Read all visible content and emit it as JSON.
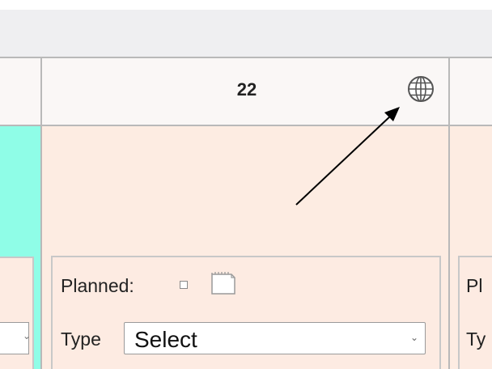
{
  "calendar": {
    "day_number": "22",
    "globe_icon": "globe-icon",
    "note_icon": "note-icon",
    "planned_label": "Planned:",
    "type_label": "Type",
    "type_select_value": "Select",
    "right_planned_partial": "Pl",
    "right_type_partial": "Ty",
    "colors": {
      "top_band": "#efeff1",
      "header_bg": "#faf7f6",
      "cell_bg": "#fdece2",
      "left_cell_bg": "#8ffde7",
      "border": "#b9b9b9"
    }
  }
}
